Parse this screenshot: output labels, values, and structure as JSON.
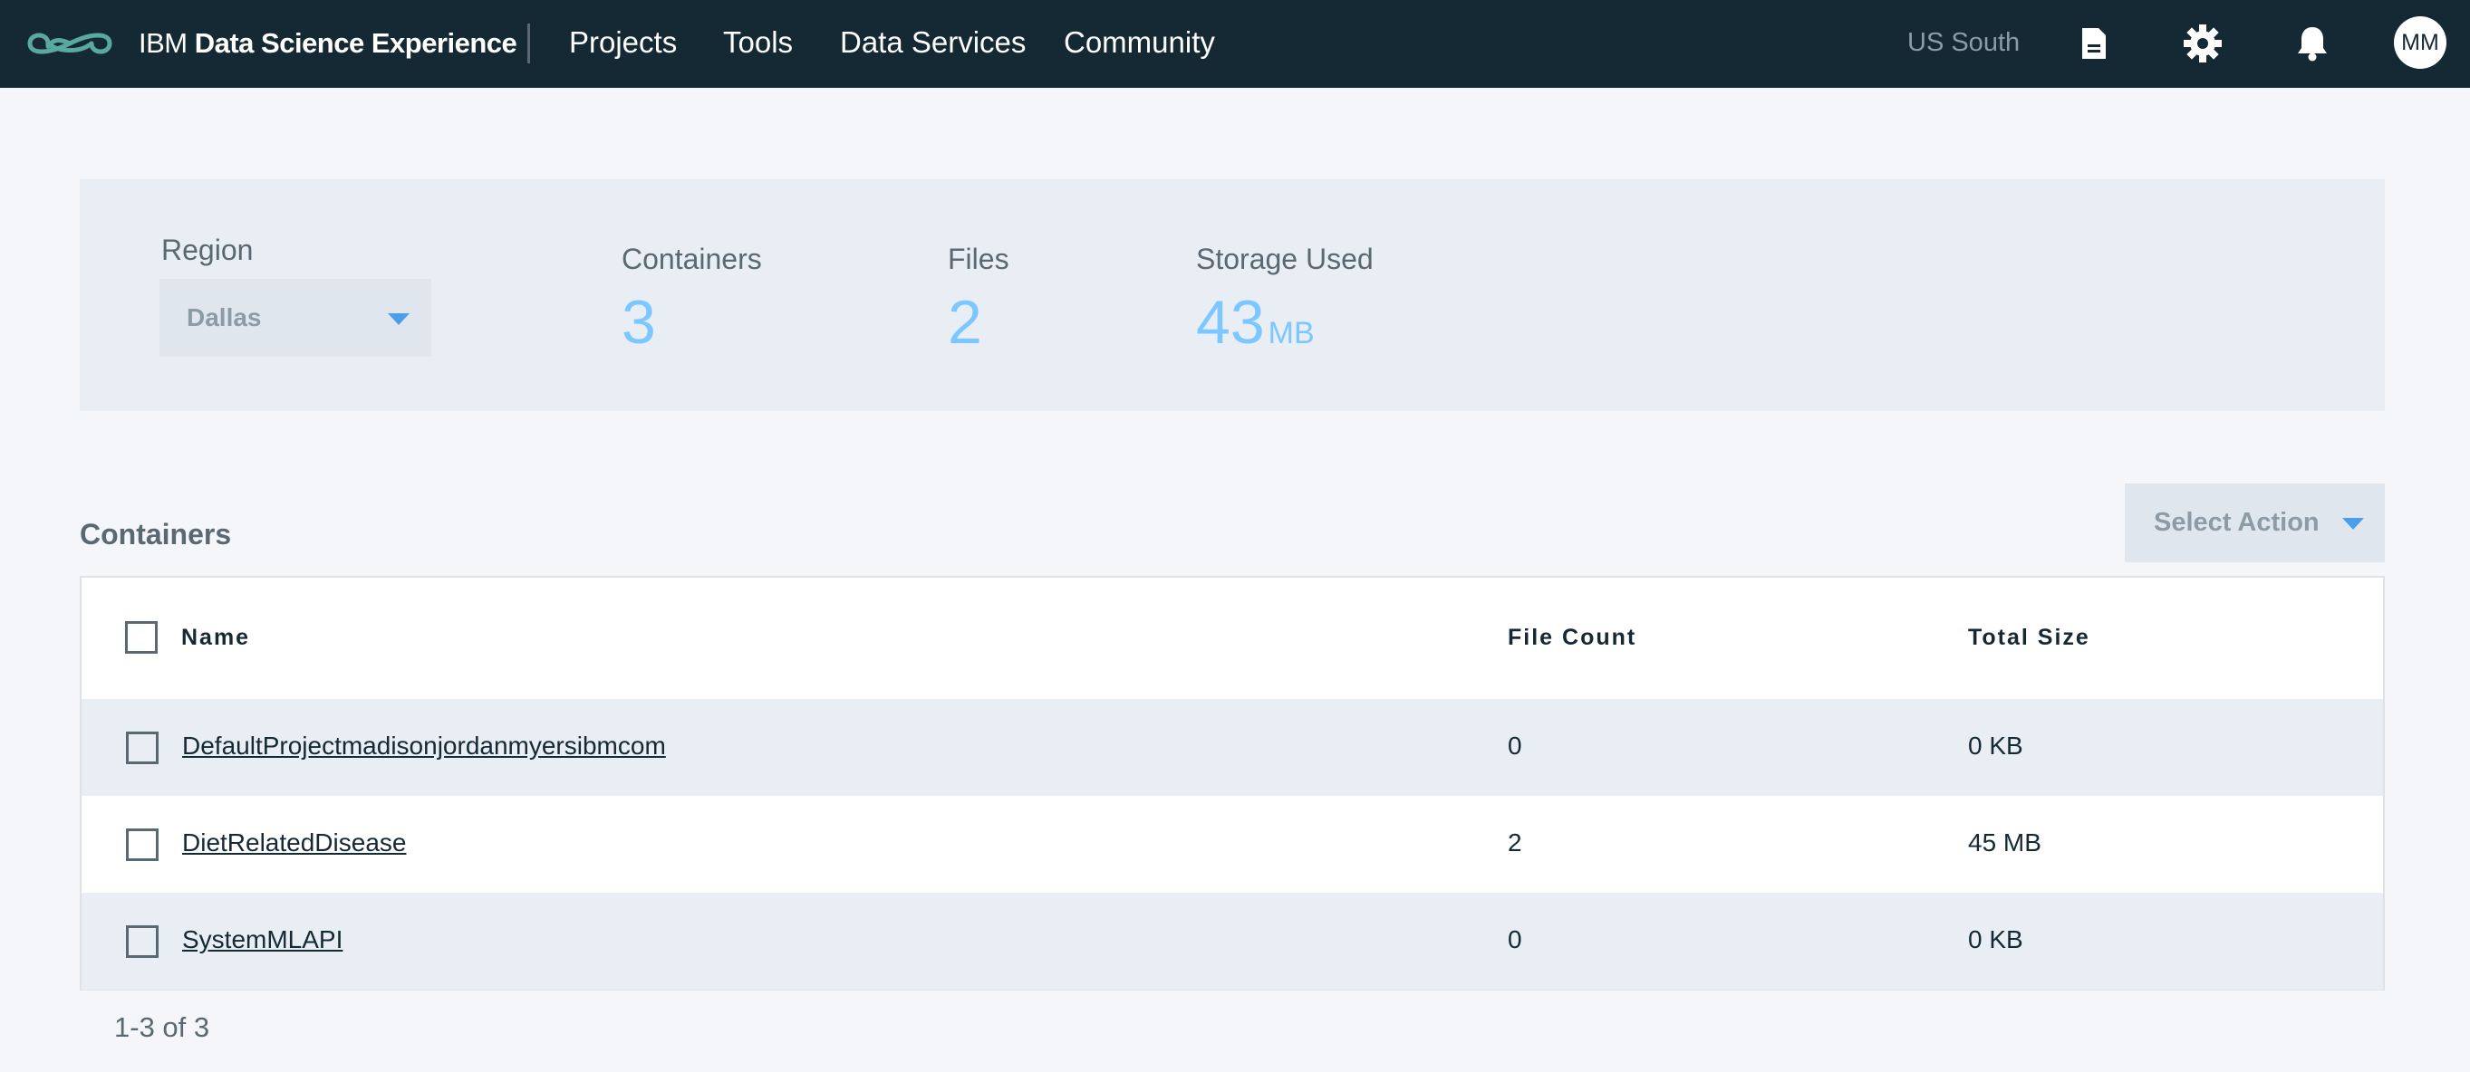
{
  "header": {
    "brand_light": "IBM ",
    "brand_bold": "Data Science Experience",
    "nav": [
      {
        "label": "Projects"
      },
      {
        "label": "Tools"
      },
      {
        "label": "Data Services"
      },
      {
        "label": "Community"
      }
    ],
    "region": "US South",
    "avatar_initials": "MM",
    "icons": [
      "document-icon",
      "gear-icon",
      "bell-icon"
    ]
  },
  "summary": {
    "region_label": "Region",
    "region_value": "Dallas",
    "containers_label": "Containers",
    "containers_value": "3",
    "files_label": "Files",
    "files_value": "2",
    "storage_label": "Storage Used",
    "storage_value": "43",
    "storage_unit": "MB"
  },
  "containers": {
    "title": "Containers",
    "select_action": "Select Action",
    "columns": [
      "Name",
      "File Count",
      "Total Size"
    ],
    "rows": [
      {
        "name": "DefaultProjectmadisonjordanmyersibmcom",
        "file_count": "0",
        "total_size": "0 KB"
      },
      {
        "name": "DietRelatedDisease",
        "file_count": "2",
        "total_size": "45 MB"
      },
      {
        "name": "SystemMLAPI",
        "file_count": "0",
        "total_size": "0 KB"
      }
    ],
    "pagination": "1-3 of 3"
  },
  "colors": {
    "topbar": "#152935",
    "accent": "#7cc7ff",
    "caret": "#4a9fe8",
    "logo": "#5aa9a1"
  }
}
